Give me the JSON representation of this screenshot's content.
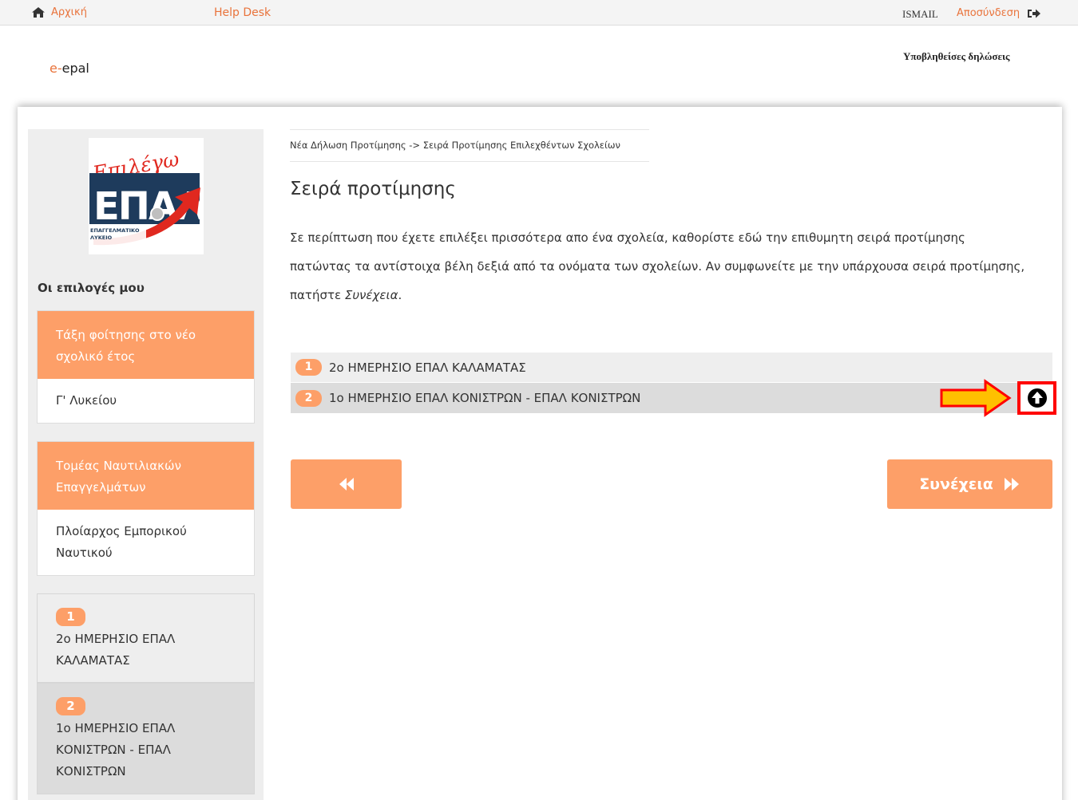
{
  "topnav": {
    "home_label": "Αρχική",
    "helpdesk_label": "Help Desk",
    "user_name": "ISMAIL",
    "logout_label": "Αποσύνδεση"
  },
  "header": {
    "brand_prefix": "e-",
    "brand_name": "epal",
    "submitted_link": "Υποβληθείσες δηλώσεις"
  },
  "logo": {
    "script_text": "Επιλέγω",
    "letters": "ΕΠΑΛ",
    "caption_line1": "ΕΠΑΓΓΕΛΜΑΤΙΚΟ",
    "caption_line2": "ΛΥΚΕΙΟ"
  },
  "sidebar": {
    "title": "Οι επιλογές μου",
    "class_card": {
      "header": "Τάξη φοίτησης στο νέο σχολικό έτος",
      "value": "Γ' Λυκείου"
    },
    "sector_card": {
      "header": "Τομέας Ναυτιλιακών Επαγγελμάτων",
      "value": "Πλοίαρχος Εμπορικού Ναυτικού"
    },
    "selected_schools": [
      {
        "num": "1",
        "name": "2ο ΗΜΕΡΗΣΙΟ ΕΠΑΛ ΚΑΛΑΜΑΤΑΣ"
      },
      {
        "num": "2",
        "name": "1ο ΗΜΕΡΗΣΙΟ ΕΠΑΛ ΚΟΝΙΣΤΡΩΝ - ΕΠΑΛ ΚΟΝΙΣΤΡΩΝ"
      }
    ]
  },
  "main": {
    "breadcrumb": "Νέα Δήλωση Προτίμησης -> Σειρά Προτίμησης Επιλεχθέντων Σχολείων",
    "title": "Σειρά προτίμησης",
    "description": "Σε περίπτωση που έχετε επιλέξει πρισσότερα απο ένα σχολεία, καθορίστε εδώ την επιθυμητη σειρά προτίμησης πατώντας τα αντίστοιχα βέλη δεξιά από τα ονόματα των σχολείων. Αν συμφωνείτε με την υπάρχουσα σειρά προτίμησης, πατήστε ",
    "description_emph": "Συνέχεια",
    "description_end": ".",
    "schools": [
      {
        "num": "1",
        "name": "2ο ΗΜΕΡΗΣΙΟ ΕΠΑΛ ΚΑΛΑΜΑΤΑΣ"
      },
      {
        "num": "2",
        "name": "1ο ΗΜΕΡΗΣΙΟ ΕΠΑΛ ΚΟΝΙΣΤΡΩΝ - ΕΠΑΛ ΚΟΝΙΣΤΡΩΝ"
      }
    ],
    "next_label": "Συνέχεια"
  },
  "colors": {
    "accent": "#fd9f68",
    "link": "#e9733b",
    "highlight_border": "#ff0000",
    "arrow_fill": "#ffc000"
  },
  "icons": {
    "home": "home-icon",
    "logout": "sign-out-icon",
    "move_up": "arrow-circle-up-icon",
    "back": "fast-backward-icon",
    "next": "fast-forward-icon",
    "annotation": "right-arrow-annotation"
  }
}
